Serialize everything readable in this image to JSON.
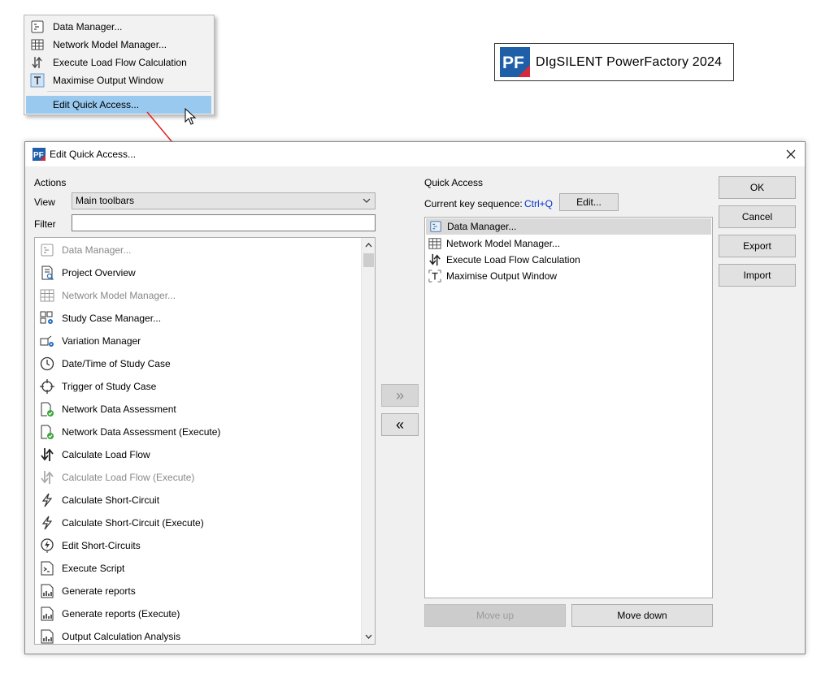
{
  "context_menu": {
    "items": [
      {
        "label": "Data Manager...",
        "icon": "data-manager-icon"
      },
      {
        "label": "Network Model Manager...",
        "icon": "grid-table-icon"
      },
      {
        "label": "Execute Load Flow Calculation",
        "icon": "load-flow-icon"
      },
      {
        "label": "Maximise Output Window",
        "icon": "output-window-icon"
      }
    ],
    "edit_item": "Edit Quick Access..."
  },
  "brand": {
    "logo_text": "PF",
    "name": "DIgSILENT  PowerFactory  2024"
  },
  "dialog": {
    "title": "Edit Quick Access...",
    "actions_heading": "Actions",
    "view_label": "View",
    "view_value": "Main toolbars",
    "filter_label": "Filter",
    "filter_value": "",
    "actions": [
      {
        "label": "Data Manager...",
        "icon": "data-manager-icon",
        "disabled": true
      },
      {
        "label": "Project Overview",
        "icon": "project-overview-icon",
        "disabled": false
      },
      {
        "label": "Network Model Manager...",
        "icon": "grid-table-icon",
        "disabled": true
      },
      {
        "label": "Study Case Manager...",
        "icon": "study-case-manager-icon",
        "disabled": false
      },
      {
        "label": "Variation Manager",
        "icon": "variation-manager-icon",
        "disabled": false
      },
      {
        "label": "Date/Time of Study Case",
        "icon": "clock-icon",
        "disabled": false
      },
      {
        "label": "Trigger of Study Case",
        "icon": "crosshair-icon",
        "disabled": false
      },
      {
        "label": "Network Data Assessment",
        "icon": "document-check-icon",
        "disabled": false
      },
      {
        "label": "Network Data Assessment (Execute)",
        "icon": "document-check-icon",
        "disabled": false
      },
      {
        "label": "Calculate Load Flow",
        "icon": "load-flow-icon",
        "disabled": false
      },
      {
        "label": "Calculate Load Flow (Execute)",
        "icon": "load-flow-icon",
        "disabled": true
      },
      {
        "label": "Calculate Short-Circuit",
        "icon": "lightning-icon",
        "disabled": false
      },
      {
        "label": "Calculate Short-Circuit (Execute)",
        "icon": "lightning-icon",
        "disabled": false
      },
      {
        "label": "Edit Short-Circuits",
        "icon": "short-circuit-pin-icon",
        "disabled": false
      },
      {
        "label": "Execute Script",
        "icon": "script-icon",
        "disabled": false
      },
      {
        "label": "Generate reports",
        "icon": "report-icon",
        "disabled": false
      },
      {
        "label": "Generate reports (Execute)",
        "icon": "report-icon",
        "disabled": false
      },
      {
        "label": "Output Calculation Analysis",
        "icon": "report-icon",
        "disabled": false
      }
    ],
    "add_arrow": "»",
    "remove_arrow": "«",
    "quick_heading": "Quick Access",
    "key_seq_label": "Current key sequence:",
    "key_seq_value": "Ctrl+Q",
    "edit_button": "Edit...",
    "quick_items": [
      {
        "label": "Data Manager...",
        "icon": "data-manager-icon",
        "selected": true
      },
      {
        "label": "Network Model Manager...",
        "icon": "grid-table-icon",
        "selected": false
      },
      {
        "label": "Execute Load Flow Calculation",
        "icon": "load-flow-icon",
        "selected": false
      },
      {
        "label": "Maximise Output Window",
        "icon": "output-window-icon",
        "selected": false
      }
    ],
    "move_up": "Move up",
    "move_down": "Move down",
    "ok": "OK",
    "cancel": "Cancel",
    "export": "Export",
    "import": "Import"
  },
  "colors": {
    "menu_highlight": "#99c9ef",
    "key_sequence": "#0033cc",
    "annotation_arrow": "#e02020",
    "logo_blue": "#1f5fa8",
    "logo_red": "#d42a3a"
  }
}
